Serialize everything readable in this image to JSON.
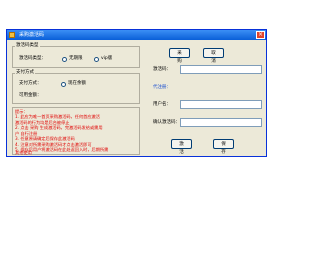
{
  "window": {
    "title": "采购激活码",
    "close_icon": "close-icon"
  },
  "code_type": {
    "group_title": "激活码类型",
    "label": "激活码类型：",
    "options": [
      "无期限",
      "vip版"
    ]
  },
  "payment": {
    "group_title": "支付方式",
    "method_label": "支付方式：",
    "method_option": "现在余额",
    "balance_label": "可用金额："
  },
  "tips": {
    "title": "提示：",
    "lines": [
      "1. 此应为唯一首页采购激活码，任何首应激活",
      "   激活码的行为均是后台被停止",
      "2. 点击 采购 生成激活码，完激活码发给或需用",
      "   户 自行注册",
      "3. 任意原请确定后保存此激活码",
      "4. 注意对所需采购激活码才点击激活即可",
      "5. 保存后用户将激活码在此处返回入时，后期所需",
      "   其他使用"
    ]
  },
  "actions": {
    "purchase": "采购",
    "cancel": "取消",
    "activate": "激活",
    "save": "保存"
  },
  "right": {
    "code_label": "激活码：",
    "code_value": "",
    "register_heading": "代注册：",
    "username_label": "用户名：",
    "username_value": "",
    "confirm_code_label": "确认激活码：",
    "confirm_code_value": ""
  }
}
